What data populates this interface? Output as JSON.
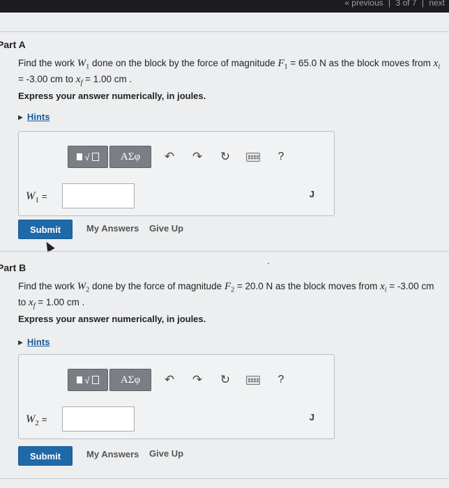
{
  "nav": {
    "previous": "« previous",
    "sep1": "|",
    "position": "3 of 7",
    "sep2": "|",
    "next": "next"
  },
  "partA": {
    "title": "Part A",
    "q_pre": "Find the work ",
    "var": "W",
    "var_sub": "1",
    "q_mid1": " done on the block by the force of magnitude ",
    "force": "F",
    "force_sub": "1",
    "force_val": " = 65.0 N",
    "q_mid2": " as the block moves from ",
    "xi": "x",
    "xi_sub": "i",
    "xi_val": " = -3.00 cm",
    "to": " to ",
    "xf": "x",
    "xf_sub": "f",
    "xf_val": " = 1.00 cm",
    "q_end": " .",
    "instruction": "Express your answer numerically, in joules.",
    "hints": "Hints",
    "answer_label": "W",
    "answer_sub": "1",
    "eq": "=",
    "answer_value": "",
    "unit": "J",
    "submit": "Submit",
    "my_answers": "My Answers",
    "give_up": "Give Up"
  },
  "partB": {
    "title": "Part B",
    "q_pre": "Find the work ",
    "var": "W",
    "var_sub": "2",
    "q_mid1": " done by the force of magnitude ",
    "force": "F",
    "force_sub": "2",
    "force_val": " = 20.0 N",
    "q_mid2": " as the block moves from ",
    "xi": "x",
    "xi_sub": "i",
    "xi_val": " = -3.00 cm",
    "to": " to ",
    "xf": "x",
    "xf_sub": "f",
    "xf_val": " = 1.00 cm",
    "q_end": " .",
    "instruction": "Express your answer numerically, in joules.",
    "hints": "Hints",
    "answer_label": "W",
    "answer_sub": "2",
    "eq": "=",
    "answer_value": "",
    "unit": "J",
    "submit": "Submit",
    "my_answers": "My Answers",
    "give_up": "Give Up"
  },
  "toolbar": {
    "greek": "ΑΣφ",
    "templates_icon": "templates-icon",
    "undo_icon": "undo-icon",
    "redo_icon": "redo-icon",
    "reset_icon": "reset-icon",
    "keyboard_icon": "keyboard-icon",
    "help": "?"
  },
  "colors": {
    "submit_bg": "#1f69a8",
    "hint_link": "#1a5a96",
    "toolbar_btn": "#7a7f85"
  }
}
